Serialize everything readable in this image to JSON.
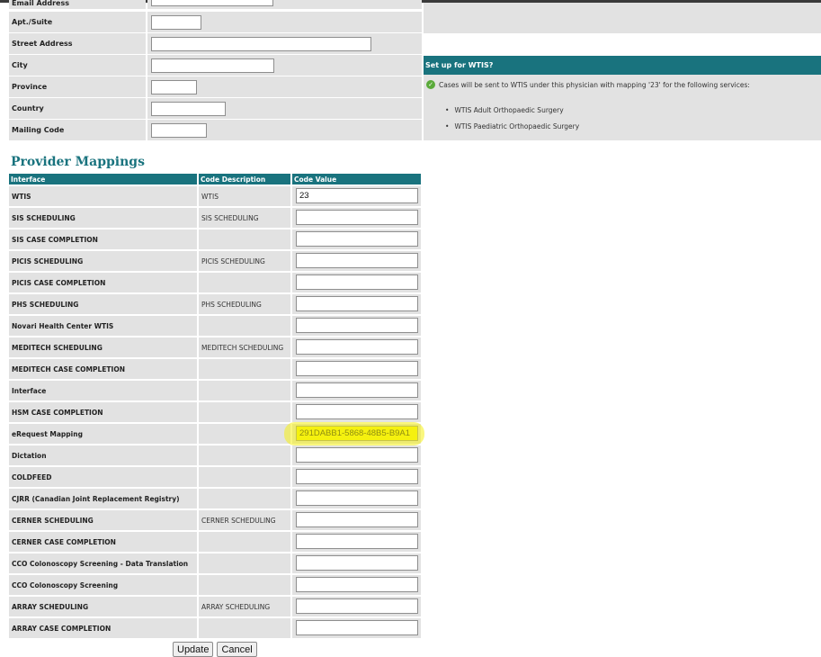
{
  "address": {
    "email_label": "Email Address",
    "rows": [
      {
        "label": "Apt./Suite",
        "value": ""
      },
      {
        "label": "Street Address",
        "value": ""
      },
      {
        "label": "City",
        "value": ""
      },
      {
        "label": "Province",
        "value": ""
      },
      {
        "label": "Country",
        "value": ""
      },
      {
        "label": "Mailing Code",
        "value": ""
      }
    ]
  },
  "wtis": {
    "title": "Set up for WTIS?",
    "message": "Cases will be sent to WTIS under this physician with mapping '23' for the following services:",
    "services": [
      "WTIS Adult Orthopaedic Surgery",
      "WTIS Paediatric Orthopaedic Surgery"
    ]
  },
  "mappings": {
    "title": "Provider Mappings",
    "headers": {
      "interface": "Interface",
      "description": "Code Description",
      "value": "Code Value"
    },
    "rows": [
      {
        "interface": "WTIS",
        "description": "WTIS",
        "value": "23"
      },
      {
        "interface": "SIS SCHEDULING",
        "description": "SIS SCHEDULING",
        "value": ""
      },
      {
        "interface": "SIS CASE COMPLETION",
        "description": "",
        "value": ""
      },
      {
        "interface": "PICIS SCHEDULING",
        "description": "PICIS SCHEDULING",
        "value": ""
      },
      {
        "interface": "PICIS CASE COMPLETION",
        "description": "",
        "value": ""
      },
      {
        "interface": "PHS SCHEDULING",
        "description": "PHS SCHEDULING",
        "value": ""
      },
      {
        "interface": "Novari Health Center WTIS",
        "description": "",
        "value": ""
      },
      {
        "interface": "MEDITECH SCHEDULING",
        "description": "MEDITECH SCHEDULING",
        "value": ""
      },
      {
        "interface": "MEDITECH CASE COMPLETION",
        "description": "",
        "value": ""
      },
      {
        "interface": "Interface",
        "description": "",
        "value": ""
      },
      {
        "interface": "HSM CASE COMPLETION",
        "description": "",
        "value": ""
      },
      {
        "interface": "eRequest Mapping",
        "description": "",
        "value": "291DABB1-5868-48B5-B9A1"
      },
      {
        "interface": "Dictation",
        "description": "",
        "value": ""
      },
      {
        "interface": "COLDFEED",
        "description": "",
        "value": ""
      },
      {
        "interface": "CJRR (Canadian Joint Replacement Registry)",
        "description": "",
        "value": ""
      },
      {
        "interface": "CERNER SCHEDULING",
        "description": "CERNER SCHEDULING",
        "value": ""
      },
      {
        "interface": "CERNER CASE COMPLETION",
        "description": "",
        "value": ""
      },
      {
        "interface": "CCO Colonoscopy Screening - Data Translation",
        "description": "",
        "value": ""
      },
      {
        "interface": "CCO Colonoscopy Screening",
        "description": "",
        "value": ""
      },
      {
        "interface": "ARRAY SCHEDULING",
        "description": "ARRAY SCHEDULING",
        "value": ""
      },
      {
        "interface": "ARRAY CASE COMPLETION",
        "description": "",
        "value": ""
      }
    ]
  },
  "buttons": {
    "update": "Update",
    "cancel": "Cancel"
  },
  "colors": {
    "header_teal": "#19737e",
    "row_grey": "#e2e2e2",
    "highlight": "#f4f20a"
  }
}
